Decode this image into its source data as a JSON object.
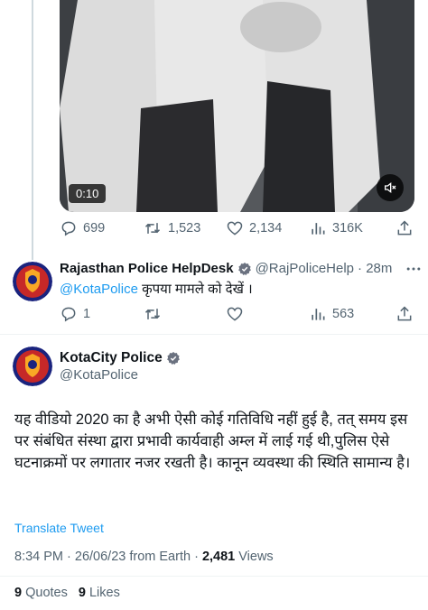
{
  "video": {
    "time": "0:10"
  },
  "tweet1_actions": {
    "replies": "699",
    "retweets": "1,523",
    "likes": "2,134",
    "views": "316K"
  },
  "reply_tweet": {
    "name": "Rajasthan Police HelpDesk",
    "handle": "@RajPoliceHelp",
    "time": "· 28m",
    "mention": "@KotaPolice",
    "text": " कृपया मामले को देखें ।",
    "replies": "1",
    "views": "563"
  },
  "main_tweet": {
    "name": "KotaCity Police",
    "handle": "@KotaPolice",
    "body": "यह वीडियो 2020 का है अभी ऐसी कोई गतिविधि नहीं हुई है, तत् समय इस पर संबंधित संस्था द्वारा प्रभावी कार्यवाही अम्ल में लाई गई थी,पुलिस ऐसे घटनाक्रमों पर लगातार नजर रखती है। कानून व्यवस्था की स्थिति सामान्य है।",
    "translate_label": "Translate Tweet",
    "timestamp": "8:34 PM · 26/06/23 from Earth · ",
    "views_count": "2,481",
    "views_label": " Views",
    "quotes_count": "9",
    "quotes_label": " Quotes",
    "likes_count": "9",
    "likes_label": " Likes"
  },
  "colors": {
    "accent": "#1d9bf0",
    "text": "#0f1419",
    "secondary": "#536471",
    "divider": "#eff3f4"
  }
}
